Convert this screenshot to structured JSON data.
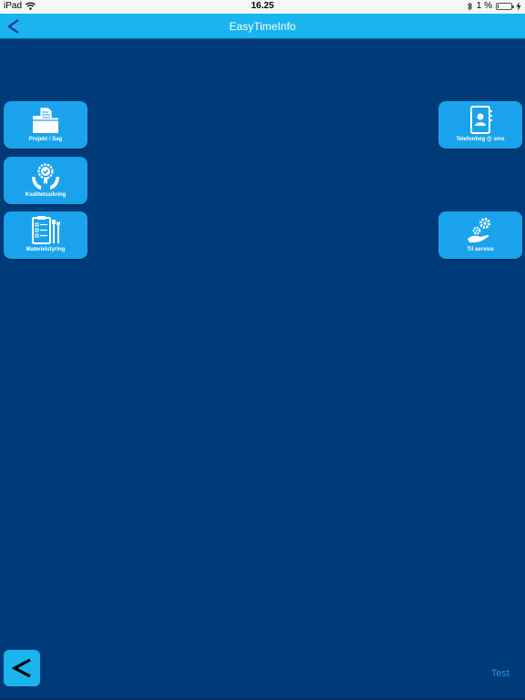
{
  "status_bar": {
    "device": "iPad",
    "time": "16.25",
    "battery_text": "1 %",
    "battery_level_percent": 1
  },
  "nav_bar": {
    "title": "EasyTimeInfo",
    "back_symbol": "<",
    "color": "#1ab4ee"
  },
  "background_color": "#003b79",
  "tiles": [
    {
      "label": "Projekt / Sag",
      "icon": "folder-documents-icon"
    },
    {
      "label": "Kvalitetssikring",
      "icon": "quality-badge-hands-icon"
    },
    {
      "label": "Materielstyring",
      "icon": "clipboard-tools-icon"
    },
    {
      "label": "Telefonbog @ sms",
      "icon": "contact-book-icon"
    },
    {
      "label": "Til service",
      "icon": "hand-gears-icon"
    }
  ],
  "bottom": {
    "back_symbol": "<",
    "test_link": "Test"
  }
}
